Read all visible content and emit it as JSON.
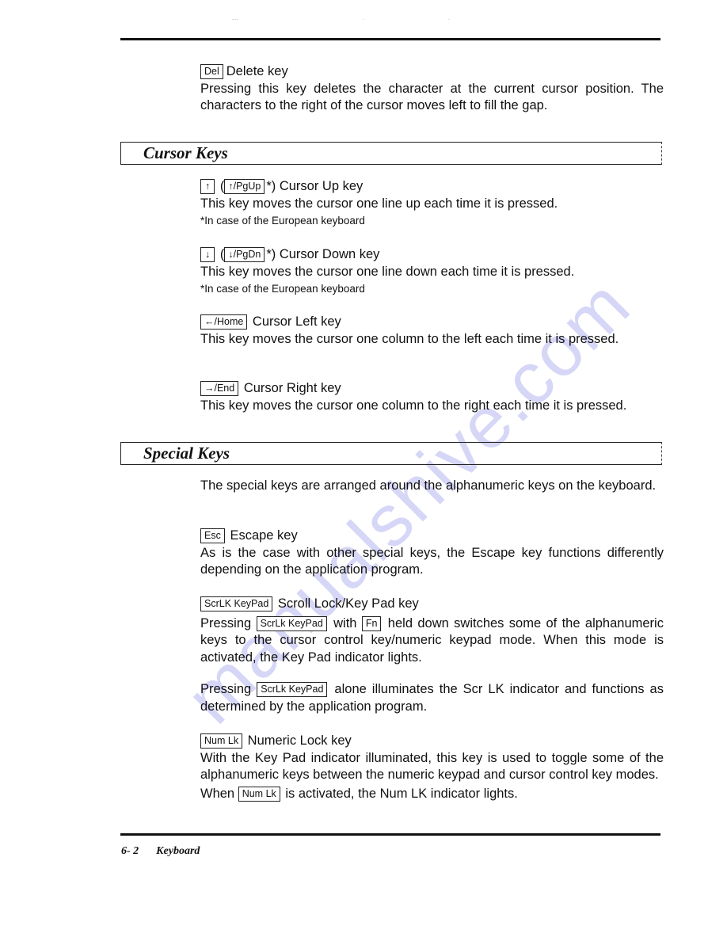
{
  "watermark": "manualshive.com",
  "delete": {
    "key": "Del",
    "title": "Delete key",
    "body": "Pressing this key deletes the character at the current cursor position. The characters to the right of the cursor moves left to fill the gap."
  },
  "sections": {
    "cursor": "Cursor Keys",
    "special": "Special Keys"
  },
  "cursor_keys": {
    "up": {
      "key": "↑",
      "alt_key": "↑/PgUp",
      "title": "Cursor Up key",
      "body": "This key moves the cursor one line up each time it is pressed.",
      "note": "*In case of the European keyboard"
    },
    "down": {
      "key": "↓",
      "alt_key": "↓/PgDn",
      "title": "Cursor Down key",
      "body": "This key moves the cursor one line down each time it is pressed.",
      "note": "*In case of the European keyboard"
    },
    "left": {
      "key": "←/Home",
      "title": "Cursor Left key",
      "body": "This key moves the cursor one column to the left each time it is pressed."
    },
    "right": {
      "key": "→/End",
      "title": "Cursor Right key",
      "body": "This key moves the cursor one column to the right each time it is pressed."
    }
  },
  "special_keys": {
    "intro": "The special keys are arranged around the alphanumeric keys on the keyboard.",
    "esc": {
      "key": "Esc",
      "title": "Escape key",
      "body": "As is the case with other special keys, the Escape key functions differently depending on the application program."
    },
    "scroll": {
      "key": "ScrLK KeyPad",
      "title": "Scroll Lock/Key Pad key",
      "p1_pre": "Pressing",
      "p1_key": "ScrLk KeyPad",
      "p1_mid": "with",
      "p1_key2": "Fn",
      "p1_post": "held down switches some of the alphanumeric keys to the cursor control key/numeric keypad mode. When this mode is activated, the Key Pad indicator lights.",
      "p2_pre": "Pressing",
      "p2_key": "ScrLk KeyPad",
      "p2_post": "alone illuminates the Scr LK indicator and functions as determined by the application program."
    },
    "numlock": {
      "key": "Num Lk",
      "title": "Numeric Lock key",
      "body": "With the Key Pad indicator illuminated, this key is used to toggle some of the alphanumeric keys between the numeric keypad and cursor control key modes.",
      "p2_pre": "When",
      "p2_key": "Num Lk",
      "p2_post": "is activated, the Num LK indicator lights."
    }
  },
  "footer": {
    "page": "6- 2",
    "chapter": "Keyboard"
  }
}
